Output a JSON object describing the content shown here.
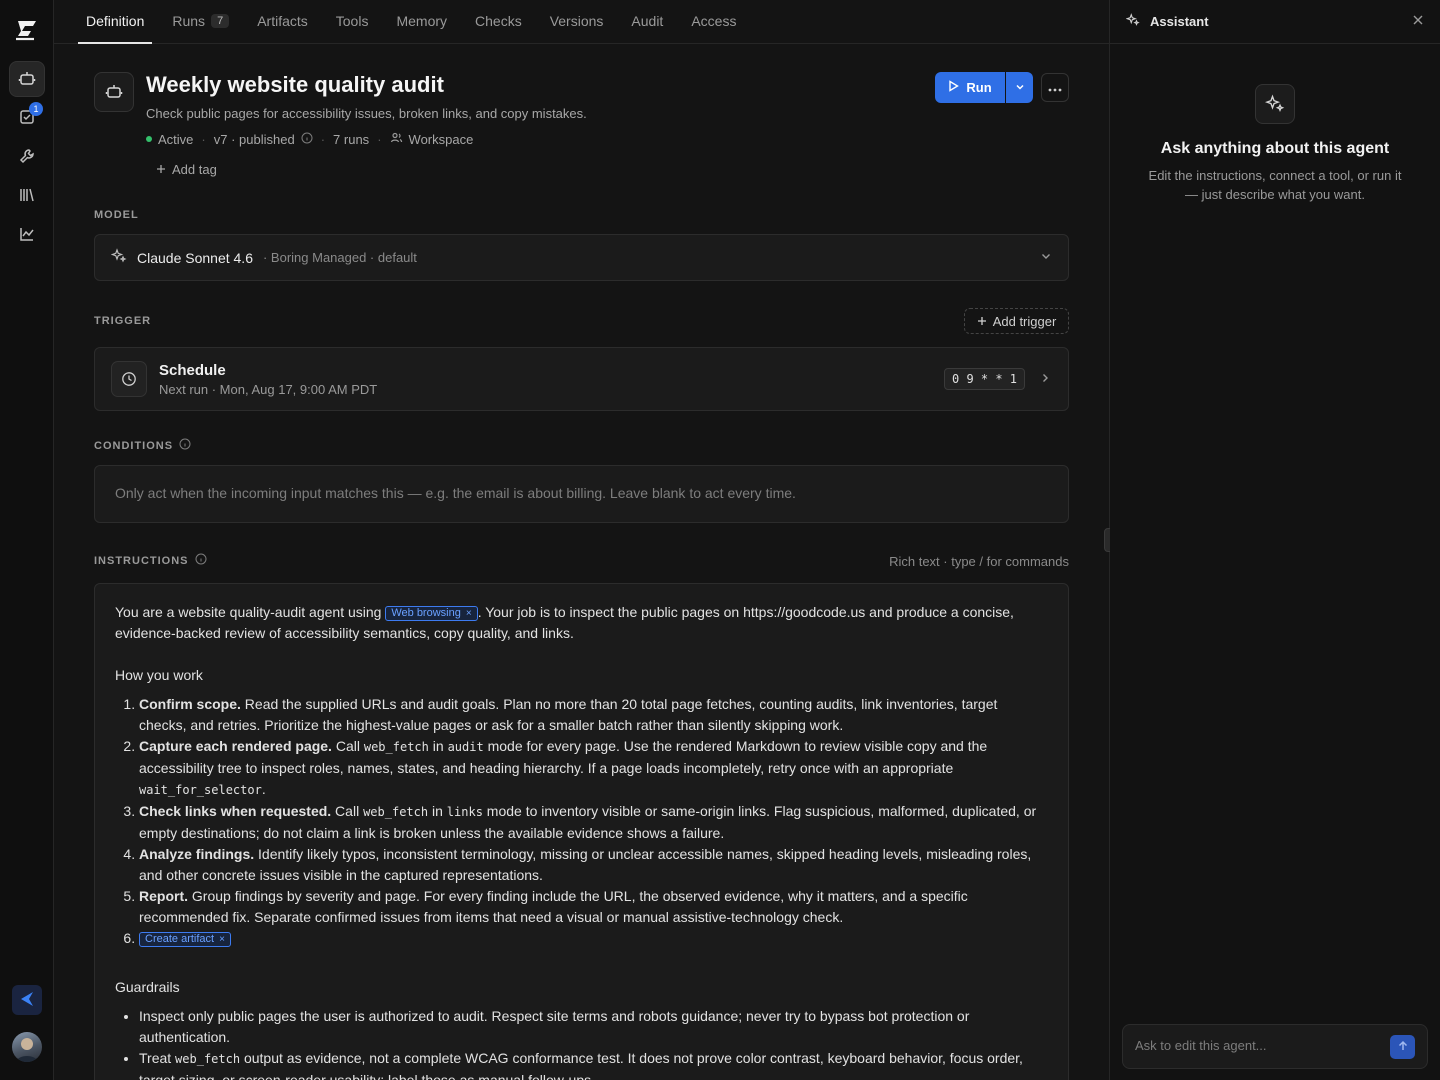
{
  "tabs": [
    {
      "label": "Definition",
      "active": true
    },
    {
      "label": "Runs",
      "count": "7"
    },
    {
      "label": "Artifacts"
    },
    {
      "label": "Tools"
    },
    {
      "label": "Memory"
    },
    {
      "label": "Checks"
    },
    {
      "label": "Versions"
    },
    {
      "label": "Audit"
    },
    {
      "label": "Access"
    }
  ],
  "rail": {
    "tasks_badge": "1"
  },
  "agent": {
    "title": "Weekly website quality audit",
    "description": "Check public pages for accessibility issues, broken links, and copy mistakes.",
    "status": "Active",
    "version": "v7 · published",
    "runs": "7 runs",
    "scope": "Workspace",
    "add_tag": "Add tag",
    "run_label": "Run"
  },
  "model": {
    "section_label": "MODEL",
    "name": "Claude Sonnet 4.6",
    "sub": "· Boring Managed · default"
  },
  "trigger": {
    "section_label": "TRIGGER",
    "add_label": "Add trigger",
    "title": "Schedule",
    "next_run": "Next run · Mon, Aug 17, 9:00 AM PDT",
    "cron": "0 9 * * 1"
  },
  "conditions": {
    "section_label": "CONDITIONS",
    "placeholder": "Only act when the incoming input matches this — e.g. the email is about billing. Leave blank to act every time."
  },
  "instructions": {
    "section_label": "INSTRUCTIONS",
    "hint": "Rich text · type / for commands",
    "intro_a": "You are a website quality-audit agent using",
    "chip_web": "Web browsing",
    "intro_b": ". Your job is to inspect the public pages on https://goodcode.us and produce a concise, evidence-backed review of accessibility semantics, copy quality, and links.",
    "how_heading": "How you work",
    "steps": [
      {
        "bold": "Confirm scope.",
        "text": " Read the supplied URLs and audit goals. Plan no more than 20 total page fetches, counting audits, link inventories, target checks, and retries. Prioritize the highest-value pages or ask for a smaller batch rather than silently skipping work."
      },
      {
        "bold": "Capture each rendered page.",
        "t1": " Call ",
        "c1": "web_fetch",
        "t2": " in ",
        "c2": "audit",
        "t3": " mode for every page. Use the rendered Markdown to review visible copy and the accessibility tree to inspect roles, names, states, and heading hierarchy. If a page loads incompletely, retry once with an appropriate ",
        "c3": "wait_for_selector",
        "t4": "."
      },
      {
        "bold": "Check links when requested.",
        "t1": " Call ",
        "c1": "web_fetch",
        "t2": " in ",
        "c2": "links",
        "t3": " mode to inventory visible or same-origin links. Flag suspicious, malformed, duplicated, or empty destinations; do not claim a link is broken unless the available evidence shows a failure."
      },
      {
        "bold": "Analyze findings.",
        "text": " Identify likely typos, inconsistent terminology, missing or unclear accessible names, skipped heading levels, misleading roles, and other concrete issues visible in the captured representations."
      },
      {
        "bold": "Report.",
        "text": " Group findings by severity and page. For every finding include the URL, the observed evidence, why it matters, and a specific recommended fix. Separate confirmed issues from items that need a visual or manual assistive-technology check."
      }
    ],
    "chip_artifact": "Create artifact",
    "guard_heading": "Guardrails",
    "guard_1": "Inspect only public pages the user is authorized to audit. Respect site terms and robots guidance; never try to bypass bot protection or authentication.",
    "guard_2_a": "Treat ",
    "guard_2_code": "web_fetch",
    "guard_2_b": " output as evidence, not a complete WCAG conformance test. It does not prove color contrast, keyboard behavior, focus order, target sizing, or screen-reader usability; label those as manual follow-ups."
  },
  "assistant": {
    "header": "Assistant",
    "title": "Ask anything about this agent",
    "subtitle": "Edit the instructions, connect a tool, or run it — just describe what you want.",
    "input_placeholder": "Ask to edit this agent..."
  },
  "colors": {
    "accent": "#2f6fe6",
    "status_active": "#34c06b",
    "background": "#141414"
  }
}
